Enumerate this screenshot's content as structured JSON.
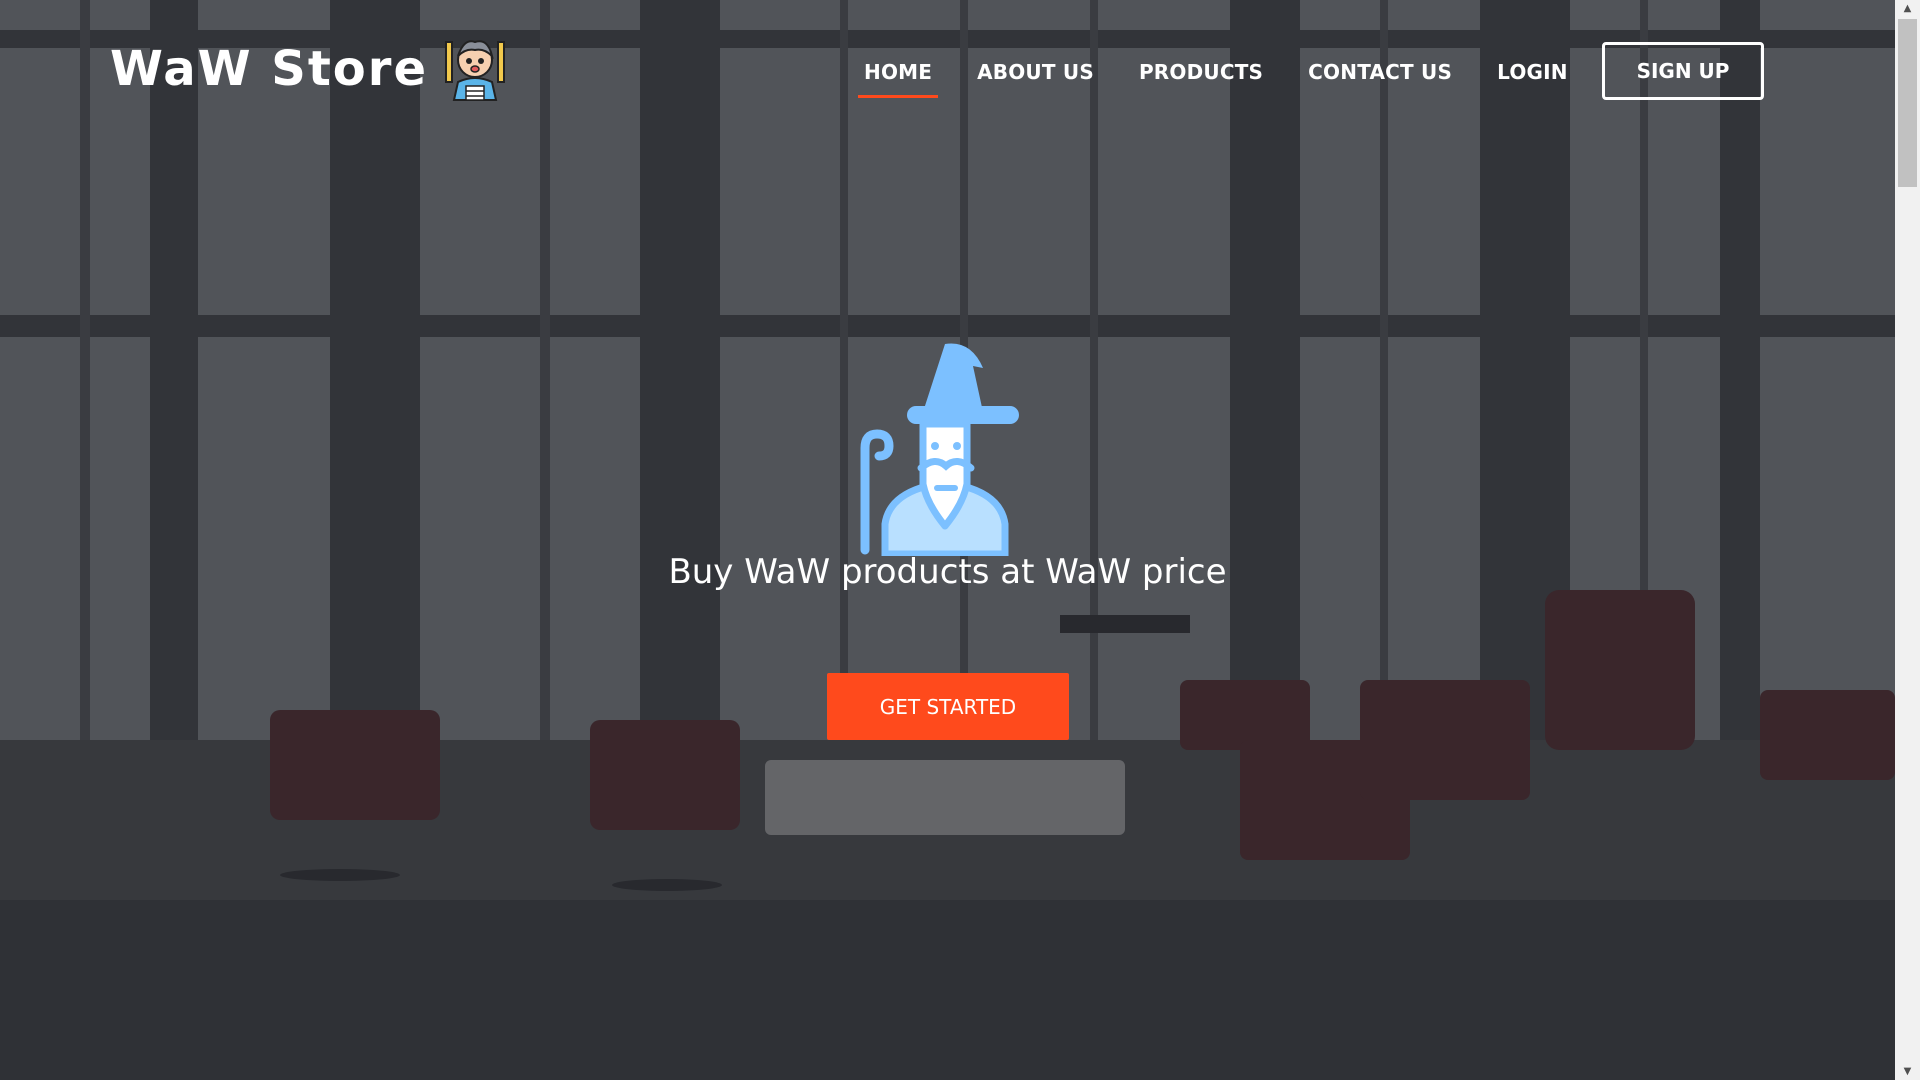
{
  "brand": {
    "name": "WaW Store",
    "logo_icon": "cartoon-character-icon"
  },
  "nav": {
    "items": [
      {
        "label": "HOME",
        "active": true
      },
      {
        "label": "ABOUT US",
        "active": false
      },
      {
        "label": "PRODUCTS",
        "active": false
      },
      {
        "label": "CONTACT US",
        "active": false
      },
      {
        "label": "LOGIN",
        "active": false
      }
    ],
    "signup_label": "SIGN UP"
  },
  "hero": {
    "icon": "wizard-icon",
    "tagline": "Buy WaW products at WaW price",
    "cta_label": "GET STARTED"
  },
  "colors": {
    "accent": "#ff4a1c",
    "wizard": "#7cc0ff",
    "text": "#ffffff"
  }
}
